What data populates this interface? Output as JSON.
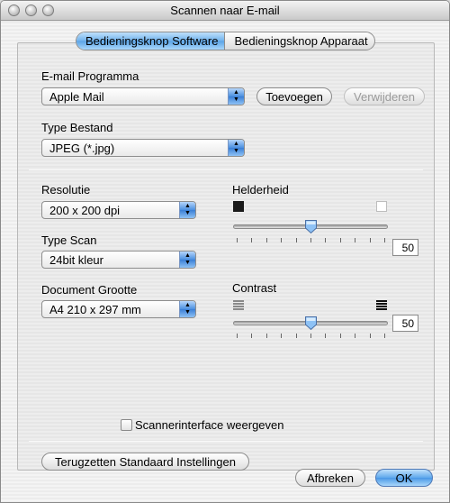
{
  "window": {
    "title": "Scannen naar E-mail"
  },
  "tabs": [
    {
      "label": "Bedieningsknop Software",
      "active": true
    },
    {
      "label": "Bedieningsknop Apparaat",
      "active": false
    }
  ],
  "email": {
    "label": "E-mail Programma",
    "value": "Apple Mail",
    "add_button": "Toevoegen",
    "remove_button": "Verwijderen"
  },
  "filetype": {
    "label": "Type Bestand",
    "value": "JPEG (*.jpg)"
  },
  "resolution": {
    "label": "Resolutie",
    "value": "200 x 200 dpi"
  },
  "scantype": {
    "label": "Type Scan",
    "value": "24bit kleur"
  },
  "docsize": {
    "label": "Document Grootte",
    "value": "A4  210 x 297 mm"
  },
  "brightness": {
    "label": "Helderheid",
    "value": "50",
    "level_percent": 50
  },
  "contrast": {
    "label": "Contrast",
    "value": "50",
    "level_percent": 50
  },
  "scanner_interface": {
    "label": "Scannerinterface weergeven",
    "checked": false
  },
  "reset_button": "Terugzetten Standaard Instellingen",
  "cancel_button": "Afbreken",
  "ok_button": "OK",
  "colors": {
    "accent_blue": "#5aa3e6"
  }
}
